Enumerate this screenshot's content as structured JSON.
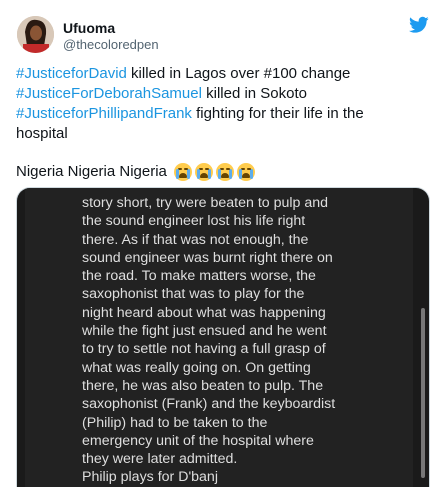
{
  "author": {
    "name": "Ufuoma",
    "handle": "@thecoloredpen"
  },
  "tweet": {
    "lines": [
      {
        "tag": "#JusticeforDavid",
        "text": " killed in Lagos over #100 change"
      },
      {
        "tag": "#JusticeForDeborahSamuel",
        "text": " killed in Sokoto"
      },
      {
        "tag": "#JusticeforPhillipandFrank",
        "text": " fighting for their life in the"
      },
      {
        "tag": "",
        "text": "hospital"
      }
    ],
    "closing": "Nigeria Nigeria Nigeria",
    "emoji_count": 4
  },
  "media": {
    "lines": [
      "story short, try were beaten to pulp and",
      "the sound engineer lost his life right",
      "there. As if that was not enough, the",
      "sound engineer was burnt right there on",
      "the road. To make matters worse, the",
      "saxophonist that was to play for the",
      "night heard about what was happening",
      "while the fight just ensued and he went",
      "to try to settle not having a full grasp of",
      "what was really going on. On getting",
      "there, he was also beaten to pulp. The",
      "saxophonist (Frank) and the keyboardist",
      "(Philip) had to be taken to the",
      "emergency unit of the hospital where",
      "they were later admitted.",
      "Philip plays for D'banj"
    ]
  },
  "colors": {
    "hashtag": "#1b95e0",
    "twitter_blue": "#1d9bf0"
  }
}
